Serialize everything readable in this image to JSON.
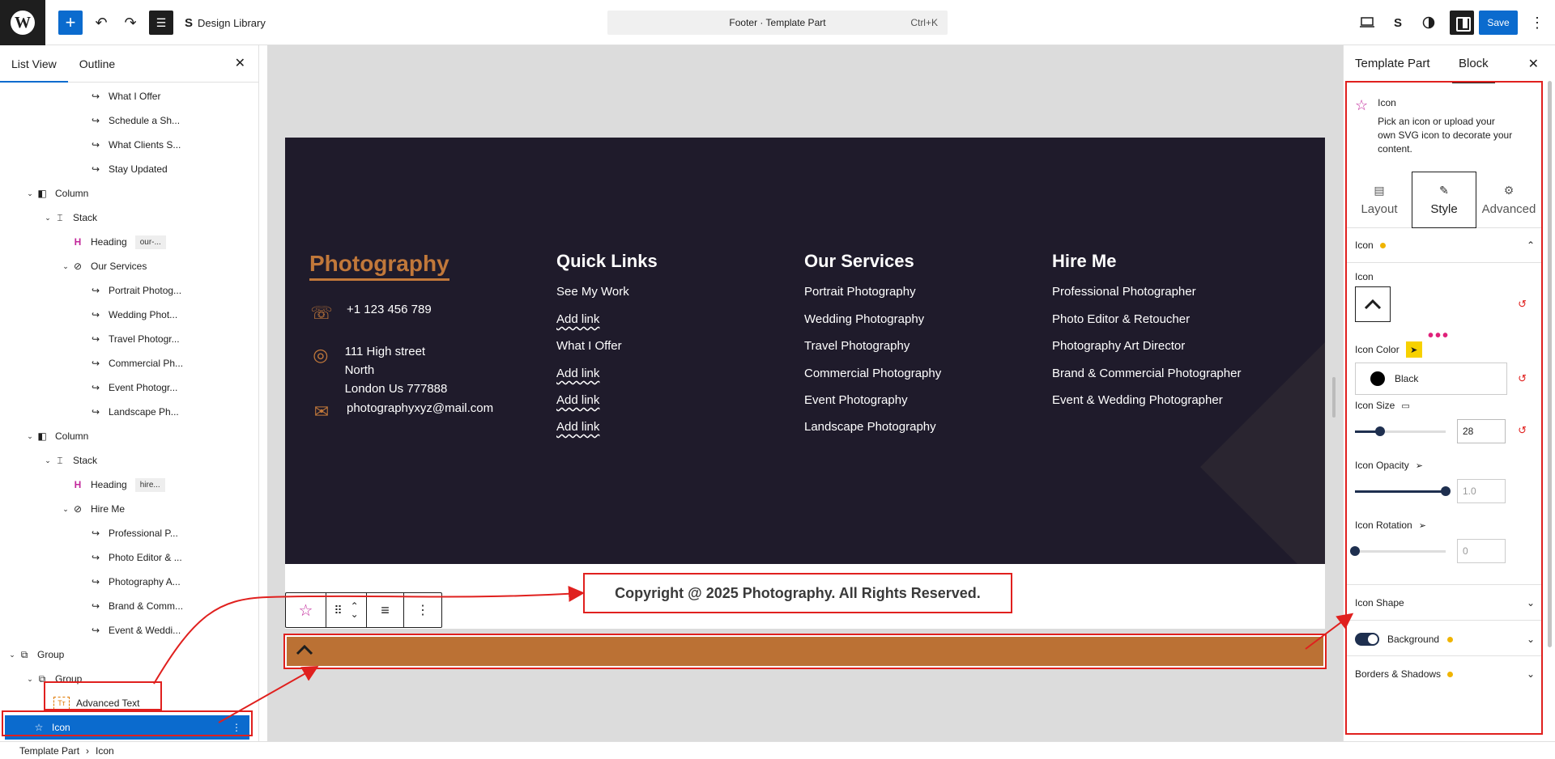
{
  "topbar": {
    "logo": "W",
    "add": "+",
    "undo": "↶",
    "redo": "↷",
    "list_view": "☰",
    "design_library": "Design Library",
    "design_library_icon": "S",
    "document_title": "Footer · Template Part",
    "shortcut": "Ctrl+K",
    "save": "Save"
  },
  "left_panel": {
    "tabs": [
      "List View",
      "Outline"
    ],
    "close": "✕",
    "rows": [
      {
        "label": "What I Offer",
        "icon": "↪",
        "chev": "",
        "indent": 3
      },
      {
        "label": "Schedule a Sh...",
        "icon": "↪",
        "chev": "",
        "indent": 3
      },
      {
        "label": "What Clients S...",
        "icon": "↪",
        "chev": "",
        "indent": 3
      },
      {
        "label": "Stay Updated",
        "icon": "↪",
        "chev": "",
        "indent": 3
      },
      {
        "label": "Column",
        "icon": "◧",
        "chev": "⌄",
        "indent": 0
      },
      {
        "label": "Stack",
        "icon": "⌶",
        "chev": "⌄",
        "indent": 1
      },
      {
        "label": "Heading",
        "icon": "H",
        "chev": "",
        "indent": 2,
        "badge": "our-..."
      },
      {
        "label": "Our Services",
        "icon": "⊘",
        "chev": "⌄",
        "indent": 2
      },
      {
        "label": "Portrait Photog...",
        "icon": "↪",
        "chev": "",
        "indent": 3
      },
      {
        "label": "Wedding Phot...",
        "icon": "↪",
        "chev": "",
        "indent": 3
      },
      {
        "label": "Travel Photogr...",
        "icon": "↪",
        "chev": "",
        "indent": 3
      },
      {
        "label": "Commercial Ph...",
        "icon": "↪",
        "chev": "",
        "indent": 3
      },
      {
        "label": "Event Photogr...",
        "icon": "↪",
        "chev": "",
        "indent": 3
      },
      {
        "label": "Landscape Ph...",
        "icon": "↪",
        "chev": "",
        "indent": 3
      },
      {
        "label": "Column",
        "icon": "◧",
        "chev": "⌄",
        "indent": 0
      },
      {
        "label": "Stack",
        "icon": "⌶",
        "chev": "⌄",
        "indent": 1
      },
      {
        "label": "Heading",
        "icon": "H",
        "chev": "",
        "indent": 2,
        "badge": "hire..."
      },
      {
        "label": "Hire Me",
        "icon": "⊘",
        "chev": "⌄",
        "indent": 2
      },
      {
        "label": "Professional P...",
        "icon": "↪",
        "chev": "",
        "indent": 3
      },
      {
        "label": "Photo Editor & ...",
        "icon": "↪",
        "chev": "",
        "indent": 3
      },
      {
        "label": "Photography A...",
        "icon": "↪",
        "chev": "",
        "indent": 3
      },
      {
        "label": "Brand & Comm...",
        "icon": "↪",
        "chev": "",
        "indent": 3
      },
      {
        "label": "Event & Weddi...",
        "icon": "↪",
        "chev": "",
        "indent": 3
      },
      {
        "label": "Group",
        "icon": "⧉",
        "chev": "⌄",
        "indent": -1
      },
      {
        "label": "Group",
        "icon": "⧉",
        "chev": "⌄",
        "indent": 0
      },
      {
        "label": "Advanced Text",
        "icon": "Tт",
        "chev": "",
        "indent": 1
      },
      {
        "label": "Icon",
        "icon": "☆",
        "chev": "",
        "indent": 0,
        "selected": true
      }
    ]
  },
  "breadcrumb": {
    "items": [
      "Template Part",
      "Icon"
    ],
    "sep": "›"
  },
  "footer": {
    "brand": "Photography",
    "contacts": [
      {
        "icon": "☏",
        "text": "+1 123 456 789"
      },
      {
        "icon": "◎",
        "text": "111 High street North\nLondon Us 777888"
      },
      {
        "icon": "✉",
        "text": "photographyxyz@mail.com"
      }
    ],
    "quick_links": {
      "heading": "Quick Links",
      "links": [
        "See My Work",
        "Add link",
        "What I Offer",
        "Add link",
        "Add link",
        "Add link"
      ]
    },
    "our_services": {
      "heading": "Our Services",
      "links": [
        "Portrait Photography",
        "Wedding Photography",
        "Travel Photography",
        "Commercial Photography",
        "Event Photography",
        "Landscape Photography"
      ]
    },
    "hire_me": {
      "heading": "Hire Me",
      "links": [
        "Professional Photographer",
        "Photo Editor & Retoucher",
        "Photography Art Director",
        "Brand & Commercial Photographer",
        "Event & Wedding Photographer"
      ]
    },
    "copyright": "Copyright @ 2025 Photography. All Rights Reserved.",
    "scroll_up": "^"
  },
  "block_toolbar": {
    "star": "☆",
    "drag": "⠿",
    "up": "⌃",
    "down": "⌄",
    "align": "≡",
    "more": "⋮"
  },
  "right_panel": {
    "tabs": [
      "Template Part",
      "Block"
    ],
    "close": "✕",
    "block_title": "Icon",
    "block_desc": "Pick an icon or upload your own SVG icon to decorate your content.",
    "subtabs": [
      {
        "label": "Layout",
        "icon": "▤"
      },
      {
        "label": "Style",
        "icon": "✎"
      },
      {
        "label": "Advanced",
        "icon": "⚙"
      }
    ],
    "section_icon": "Icon",
    "field_icon": "Icon",
    "icon_glyph": "^",
    "more_dots": "•••",
    "icon_color_label": "Icon Color",
    "icon_color_value": "Black",
    "icon_size_label": "Icon Size",
    "icon_size_value": "28",
    "icon_size_fraction": 0.28,
    "icon_opacity_label": "Icon Opacity",
    "icon_opacity_value": "1.0",
    "icon_opacity_fraction": 1.0,
    "icon_rotation_label": "Icon Rotation",
    "icon_rotation_value": "0",
    "icon_rotation_fraction": 0,
    "icon_shape": "Icon Shape",
    "background": "Background",
    "borders": "Borders & Shadows",
    "reset": "↺"
  },
  "colors": {
    "accent": "#0b6bce",
    "brand_orange": "#c1783a",
    "footer_bg": "#1f1b2b",
    "bar_orange": "#bb7134",
    "annotation_red": "#e0201e"
  }
}
